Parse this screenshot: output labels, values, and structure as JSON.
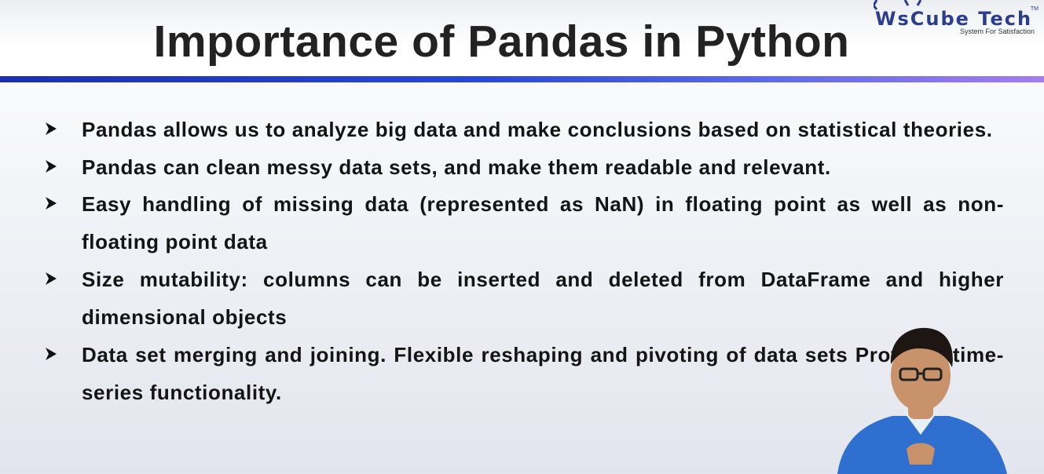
{
  "slide": {
    "title": "Importance of Pandas in Python",
    "logo": {
      "name": "WsCube Tech",
      "text": "WsCube Tech",
      "tagline": "System For Satisfaction",
      "tm": "TM"
    },
    "bullet_icon": "arrow-bullet-icon",
    "points": [
      "Pandas allows us to analyze big data and make conclusions based on statistical theories.",
      "Pandas can clean messy data sets, and make them readable and relevant.",
      "Easy handling of missing data (represented as NaN) in floating point as well as non-floating point data",
      "Size mutability: columns can be inserted and deleted from DataFrame and higher dimensional objects",
      "Data set merging and joining. Flexible reshaping and pivoting of data sets Provides time-series functionality."
    ]
  },
  "colors": {
    "accent_start": "#1c2fb0",
    "accent_end": "#a47cf0",
    "logo": "#2a3d8f",
    "text": "#141414",
    "shirt": "#2f6fd0"
  }
}
